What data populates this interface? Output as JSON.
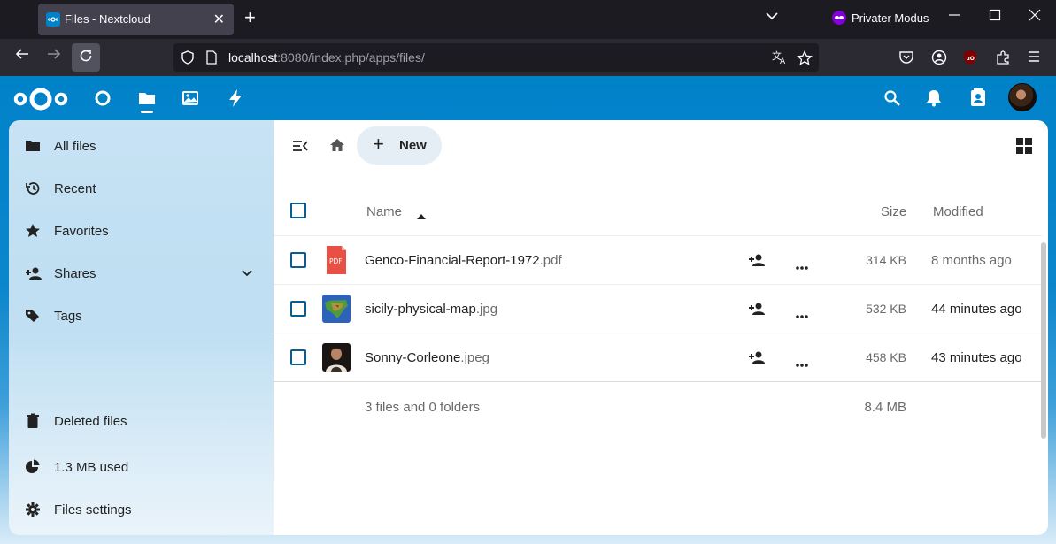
{
  "browser": {
    "tab_title": "Files - Nextcloud",
    "private_label": "Privater Modus",
    "url_host": "localhost",
    "url_rest": ":8080/index.php/apps/files/"
  },
  "sidebar": {
    "items": [
      {
        "label": "All files",
        "icon": "folder-icon"
      },
      {
        "label": "Recent",
        "icon": "history-icon"
      },
      {
        "label": "Favorites",
        "icon": "star-icon"
      },
      {
        "label": "Shares",
        "icon": "share-icon"
      },
      {
        "label": "Tags",
        "icon": "tag-icon"
      }
    ],
    "deleted_label": "Deleted files",
    "quota_label": "1.3 MB used",
    "settings_label": "Files settings"
  },
  "toolbar": {
    "new_label": "New"
  },
  "table": {
    "headers": {
      "name": "Name",
      "size": "Size",
      "modified": "Modified"
    },
    "rows": [
      {
        "base": "Genco-Financial-Report-1972",
        "ext": ".pdf",
        "size": "314 KB",
        "modified": "8 months ago",
        "thumb_label": "PDF"
      },
      {
        "base": "sicily-physical-map",
        "ext": ".jpg",
        "size": "532 KB",
        "modified": "44 minutes ago"
      },
      {
        "base": "Sonny-Corleone",
        "ext": ".jpeg",
        "size": "458 KB",
        "modified": "43 minutes ago"
      }
    ],
    "summary": "3 files and 0 folders",
    "total_size": "8.4 MB"
  },
  "colors": {
    "primary": "#0082c9",
    "checkbox": "#0a5c91",
    "pdf": "#e84f45"
  }
}
